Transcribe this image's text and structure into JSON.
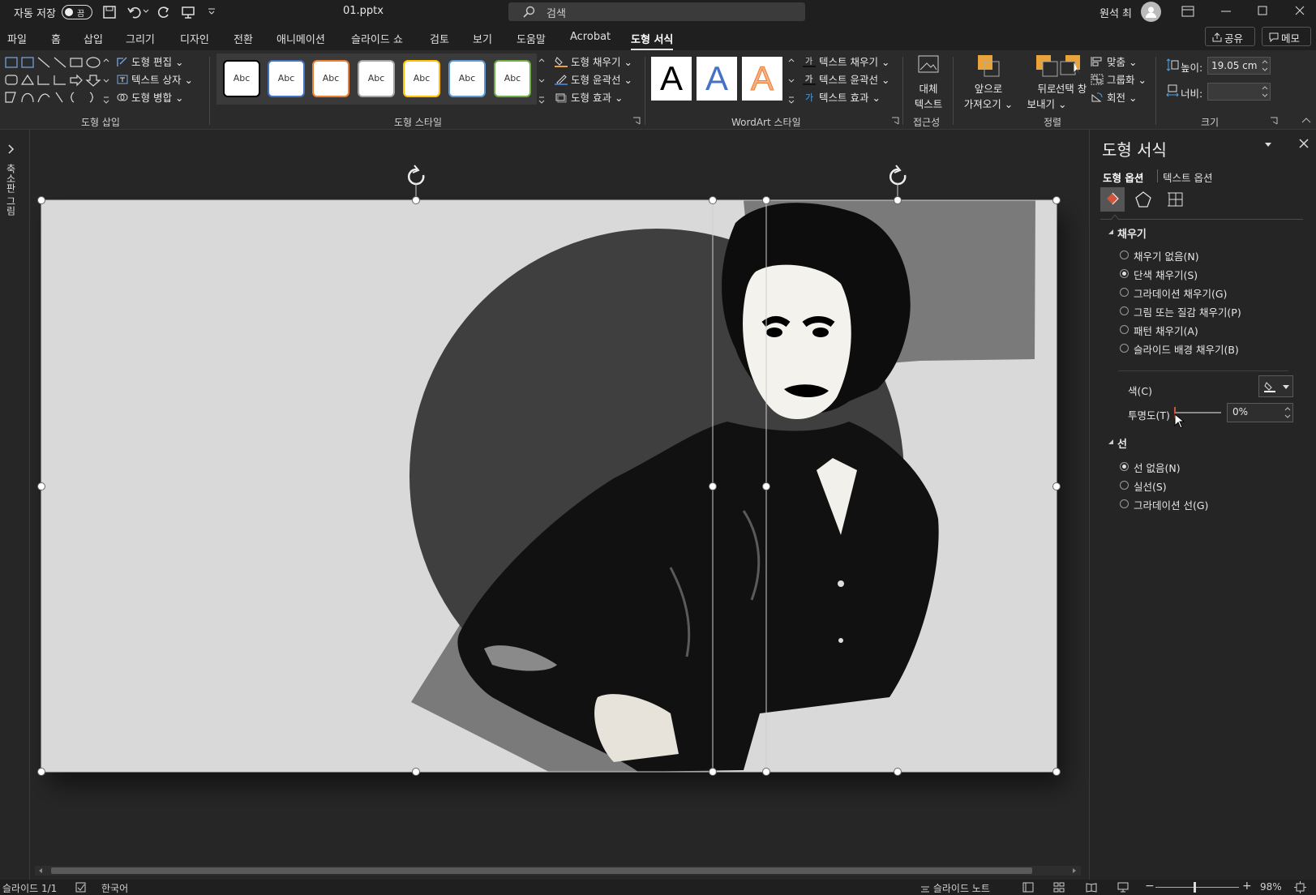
{
  "titlebar": {
    "autosave_label": "자동 저장",
    "autosave_toggle": "끔",
    "filename": "01.pptx",
    "search_placeholder": "검색",
    "user_name": "원석 최"
  },
  "tabs": [
    "파일",
    "홈",
    "삽입",
    "그리기",
    "디자인",
    "전환",
    "애니메이션",
    "슬라이드 쇼",
    "검토",
    "보기",
    "도움말",
    "Acrobat",
    "도형 서식"
  ],
  "share_label": "공유",
  "memo_label": "메모",
  "ribbon": {
    "insert_shapes": {
      "edit_shape": "도형 편집",
      "text_box": "텍스트 상자",
      "merge_shapes": "도형 병합",
      "label": "도형 삽입"
    },
    "shape_styles": {
      "style_text": "Abc",
      "fill": "도형 채우기",
      "outline": "도형 윤곽선",
      "effects": "도형 효과",
      "label": "도형 스타일"
    },
    "wordart": {
      "letter": "A",
      "text_fill": "텍스트 채우기",
      "text_outline": "텍스트 윤곽선",
      "text_effects": "텍스트 효과",
      "label": "WordArt 스타일"
    },
    "accessibility": {
      "alt_text_1": "대체",
      "alt_text_2": "텍스트",
      "label": "접근성"
    },
    "arrange": {
      "bring_forward_1": "앞으로",
      "bring_forward_2": "가져오기",
      "send_backward_1": "뒤로",
      "send_backward_2": "보내기",
      "selection_pane": "선택 창",
      "align": "맞춤",
      "group": "그룹화",
      "rotate": "회전",
      "label": "정렬"
    },
    "size": {
      "height_label": "높이:",
      "height_value": "19.05 cm",
      "width_label": "너비:",
      "width_value": "",
      "label": "크기"
    }
  },
  "sidebar_vertical_label": "축소판 그림",
  "pane": {
    "title": "도형 서식",
    "tab_shape": "도형 옵션",
    "tab_text": "텍스트 옵션",
    "fill_section": "채우기",
    "fill_options": [
      {
        "label": "채우기 없음(N)",
        "selected": false
      },
      {
        "label": "단색 채우기(S)",
        "selected": true
      },
      {
        "label": "그라데이션 채우기(G)",
        "selected": false
      },
      {
        "label": "그림 또는 질감 채우기(P)",
        "selected": false
      },
      {
        "label": "패턴 채우기(A)",
        "selected": false
      },
      {
        "label": "슬라이드 배경 채우기(B)",
        "selected": false
      }
    ],
    "color_label": "색(C)",
    "transparency_label": "투명도(T)",
    "transparency_value": "0%",
    "line_section": "선",
    "line_options": [
      {
        "label": "선 없음(N)",
        "selected": true
      },
      {
        "label": "실선(S)",
        "selected": false
      },
      {
        "label": "그라데이션 선(G)",
        "selected": false
      }
    ]
  },
  "statusbar": {
    "slide": "슬라이드 1/1",
    "language": "한국어",
    "notes": "슬라이드 노트",
    "zoom": "98%"
  }
}
